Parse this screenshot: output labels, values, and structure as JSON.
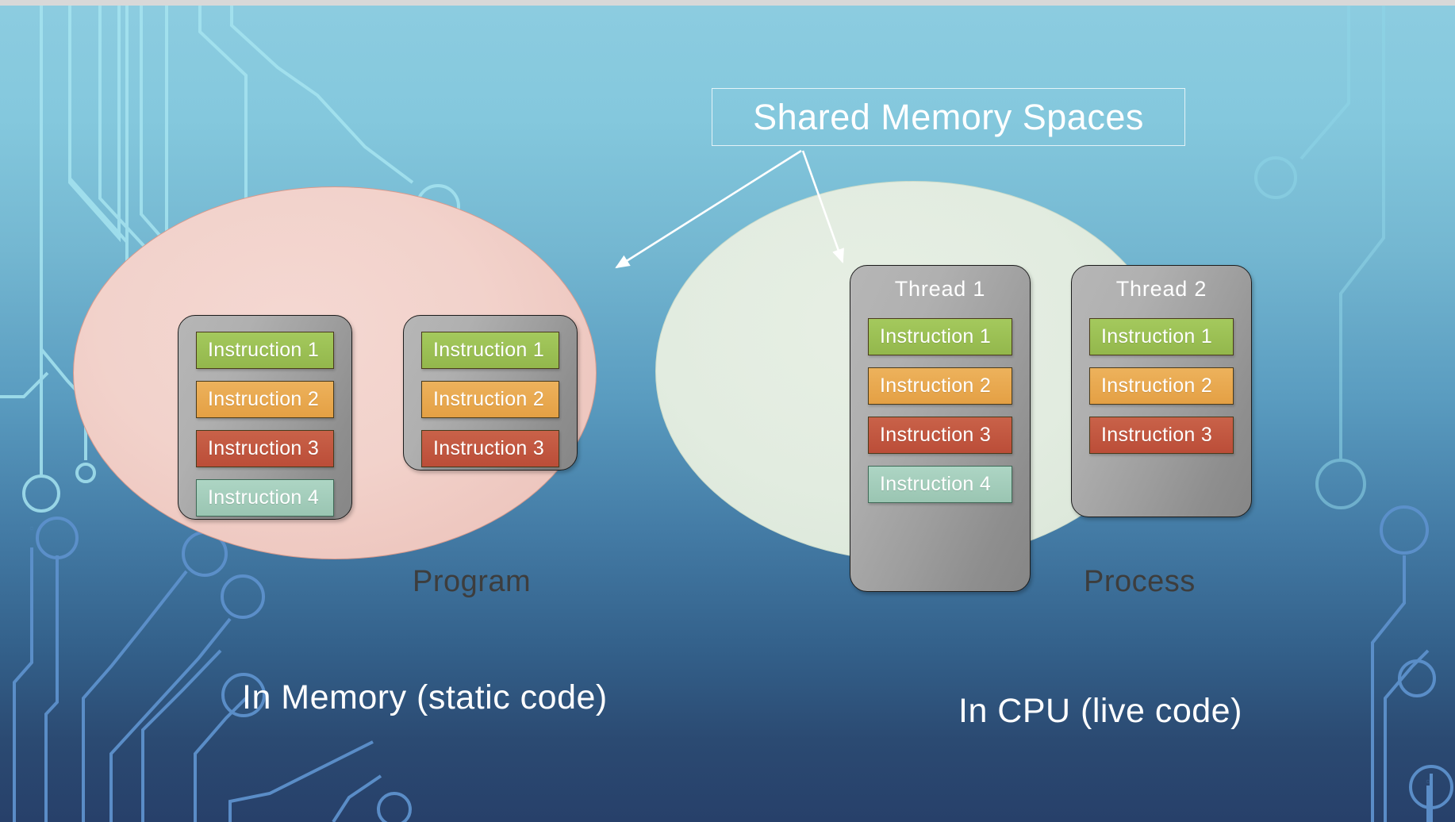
{
  "slide": {
    "title": "Shared Memory Spaces",
    "background": {
      "gradient_top": "#8ccce0",
      "gradient_bottom": "#27406a",
      "top_strip": "#d8d8d8",
      "circuit_trace_color_light": "#a9e6f2",
      "circuit_trace_color_dark": "#5b8fc9"
    },
    "colors": {
      "instruction_green": "#9cc054",
      "instruction_orange": "#e9a94e",
      "instruction_red": "#c2563f",
      "instruction_mint": "#a3cdbc",
      "instruction_border": "#4a3b1c",
      "container_gray_light": "#b6b6b6",
      "container_gray_dark": "#868686",
      "container_border": "#1c1c1c",
      "ellipse_program_fill": "#f1d0c8",
      "ellipse_process_fill": "#e1ebdf",
      "caption_text": "#3d3d3d",
      "title_text": "#ffffff",
      "arrow_color": "#ffffff"
    }
  },
  "left_group": {
    "ellipse_caption": "Program",
    "bottom_caption": "In Memory (static code)",
    "boxes": [
      {
        "name": "program-box-1",
        "label": null,
        "instructions": [
          {
            "text": "Instruction 1",
            "color": "#9cc054"
          },
          {
            "text": "Instruction 2",
            "color": "#e9a94e"
          },
          {
            "text": "Instruction 3",
            "color": "#c2563f"
          },
          {
            "text": "Instruction 4",
            "color": "#a3cdbc"
          }
        ]
      },
      {
        "name": "program-box-2",
        "label": null,
        "instructions": [
          {
            "text": "Instruction 1",
            "color": "#9cc054"
          },
          {
            "text": "Instruction 2",
            "color": "#e9a94e"
          },
          {
            "text": "Instruction 3",
            "color": "#c2563f"
          }
        ]
      }
    ]
  },
  "right_group": {
    "ellipse_caption": "Process",
    "bottom_caption": "In CPU (live code)",
    "boxes": [
      {
        "name": "thread-1",
        "label": "Thread 1",
        "instructions": [
          {
            "text": "Instruction 1",
            "color": "#9cc054"
          },
          {
            "text": "Instruction 2",
            "color": "#e9a94e"
          },
          {
            "text": "Instruction 3",
            "color": "#c2563f"
          },
          {
            "text": "Instruction 4",
            "color": "#a3cdbc"
          }
        ]
      },
      {
        "name": "thread-2",
        "label": "Thread 2",
        "instructions": [
          {
            "text": "Instruction 1",
            "color": "#9cc054"
          },
          {
            "text": "Instruction 2",
            "color": "#e9a94e"
          },
          {
            "text": "Instruction 3",
            "color": "#c2563f"
          }
        ]
      }
    ]
  },
  "annotations": {
    "arrow_left_target": "program-ellipse",
    "arrow_right_target": "process-ellipse"
  }
}
